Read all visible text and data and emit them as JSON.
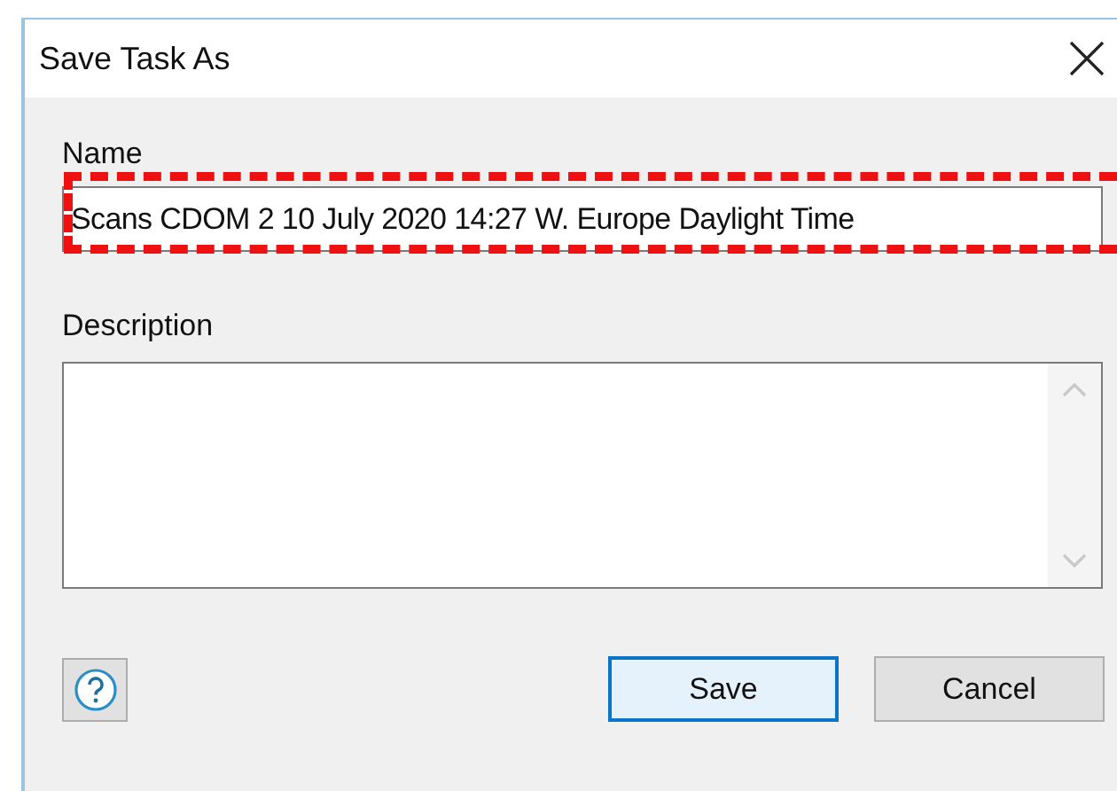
{
  "window": {
    "title": "Save Task As"
  },
  "name_field": {
    "label": "Name",
    "value": "Scans CDOM 2 10 July 2020 14:27 W. Europe Daylight Time",
    "highlighted": true
  },
  "description_field": {
    "label": "Description"
  },
  "buttons": [
    {
      "label": "Save",
      "default": true
    },
    {
      "label": "Cancel",
      "default": false
    }
  ]
}
